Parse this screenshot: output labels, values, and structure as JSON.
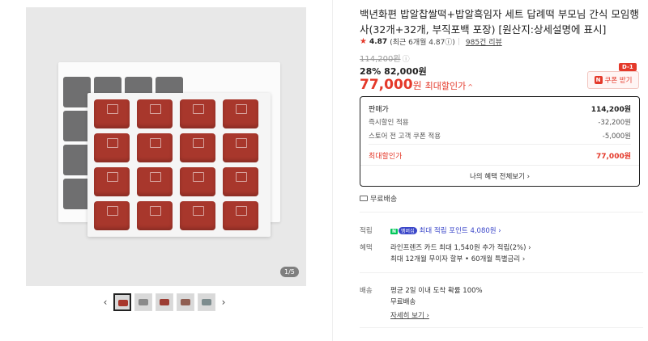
{
  "gallery": {
    "counter": "1/5",
    "prev_arrow": "‹",
    "next_arrow": "›",
    "thumb_colors": [
      "#a8372c",
      "#8a8a8a",
      "#9c3c32",
      "#8f5e52",
      "#7d8c8e"
    ]
  },
  "product": {
    "title": "백년화편 밥알찹쌀떡+밥알흑임자 세트 답례떡 부모님 간식 모임행사(32개+32개, 부직포백 포장) [원산지:상세설명에 표시]",
    "rating": "4.87",
    "rating_detail": "(최근 6개월 4.87ⓘ)",
    "reviews": "985건 리뷰",
    "original_price": "114,200원",
    "discount_line": "28% 82,000원",
    "max_price": "77,000",
    "max_price_unit": "원",
    "max_price_label": "최대할인가",
    "coupon": {
      "badge": "D-1",
      "n_badge": "N",
      "label": "쿠폰 받기"
    }
  },
  "price_box": {
    "sale_label": "판매가",
    "sale_value": "114,200원",
    "instant_label": "즉시할인 적용",
    "instant_value": "-32,200원",
    "store_label": "스토어 전 고객 쿠폰 적용",
    "store_value": "-5,000원",
    "max_label": "최대할인가",
    "max_value": "77,000원",
    "all_benefits": "나의 혜택 전체보기 ›"
  },
  "shipping_top": "무료배송",
  "details": {
    "points_label": "적립",
    "points_badge_n": "N",
    "points_badge_plus": "멤버십",
    "points_value": "최대 적립 포인트 4,080원 ›",
    "benefits_label": "혜택",
    "benefit_1": "라인프렌즈 카드 최대 1,540원 추가 적립(2%) ›",
    "benefit_2": "최대 12개월 무이자 할부 • 60개월 특별금리 ›",
    "delivery_label": "배송",
    "delivery_1": "평균 2일 이내 도착 확률 100%",
    "delivery_2": "무료배송",
    "delivery_more": "자세히 보기 ›"
  }
}
